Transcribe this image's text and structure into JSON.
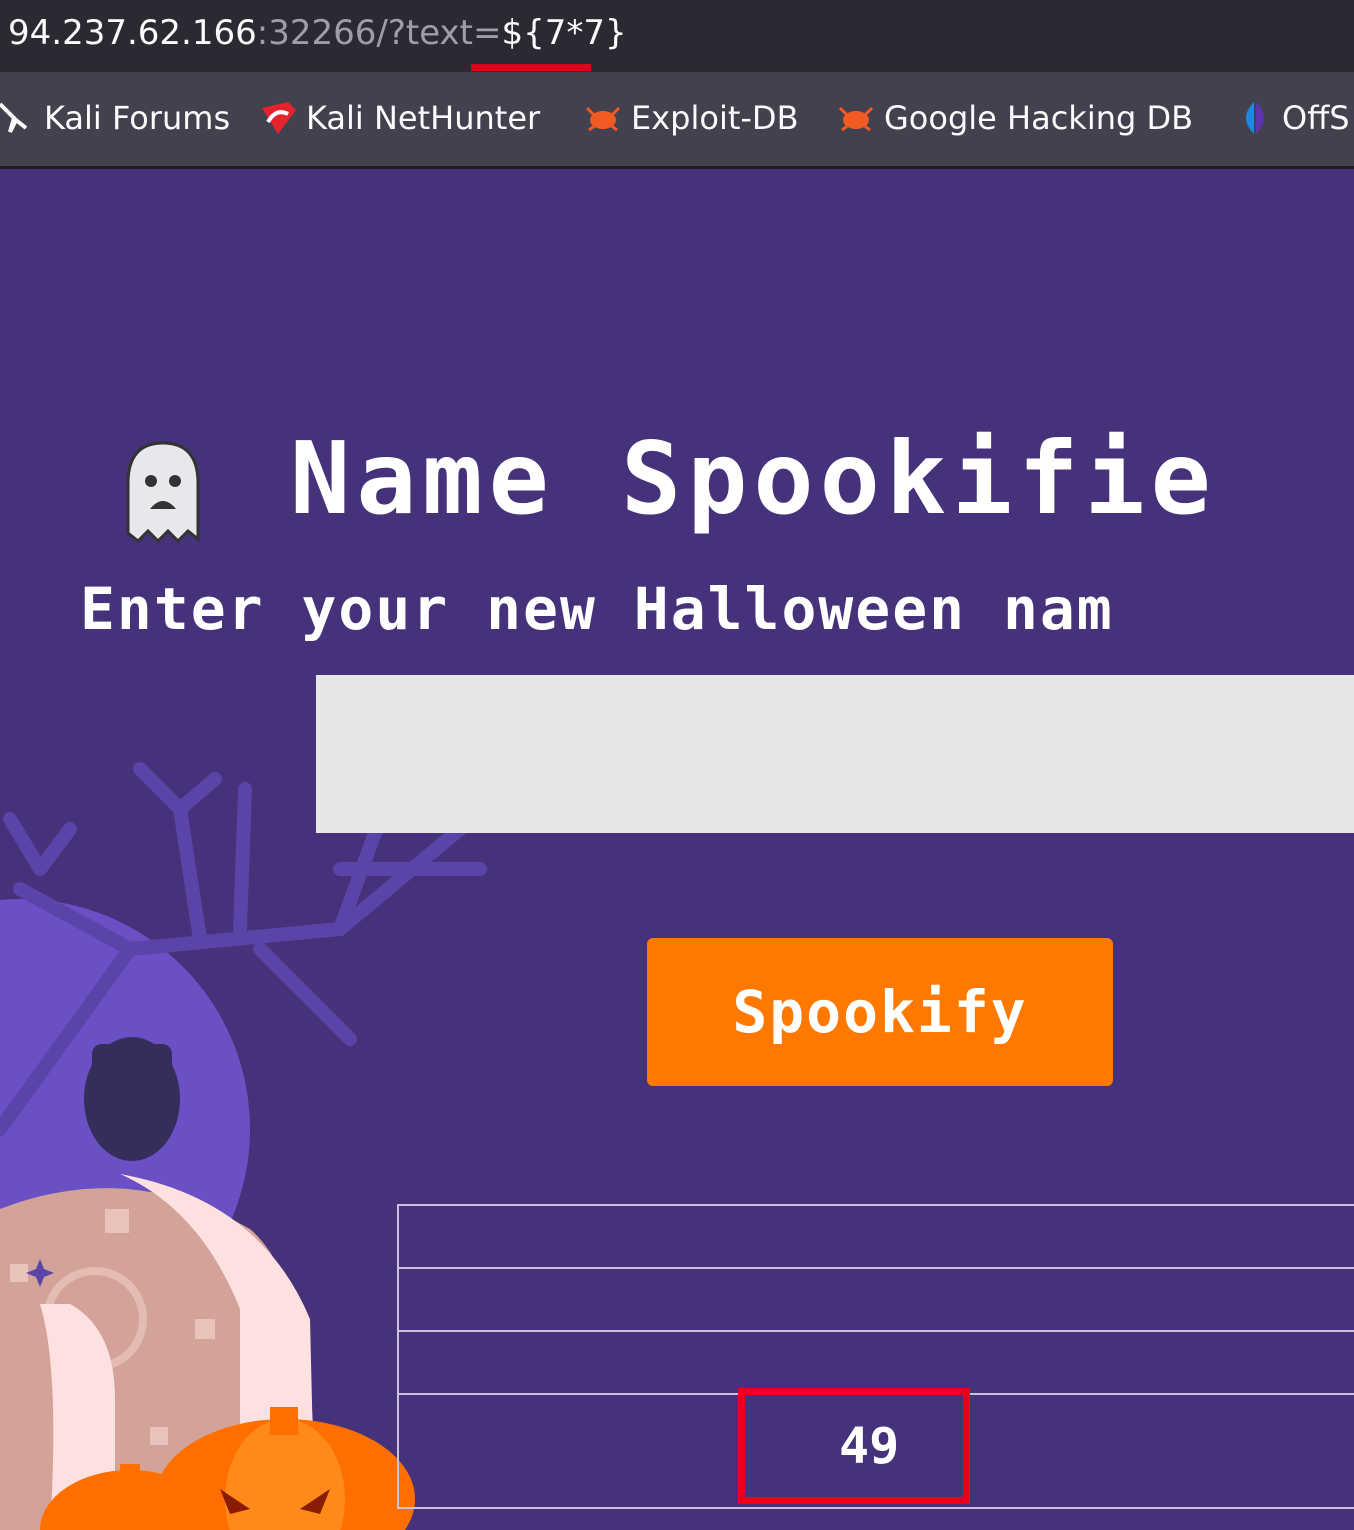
{
  "browser": {
    "url": {
      "host": "94.237.62.166",
      "path": ":32266/?text=",
      "payload": "${7*7}"
    },
    "bookmarks": [
      {
        "label": "Kali Forums",
        "icon": "kali-dragon-icon"
      },
      {
        "label": "Kali NetHunter",
        "icon": "nethunter-icon"
      },
      {
        "label": "Exploit-DB",
        "icon": "exploit-db-icon"
      },
      {
        "label": "Google Hacking DB",
        "icon": "exploit-db-icon"
      },
      {
        "label": "OffS",
        "icon": "offsec-icon"
      }
    ]
  },
  "page": {
    "title": "Name Spookifie",
    "subtitle": "Enter your new Halloween nam",
    "input_value": "",
    "button_label": "Spookify",
    "result_value": "49"
  },
  "colors": {
    "background": "#45327a",
    "button": "#ff7800",
    "highlight": "#e8001c"
  }
}
